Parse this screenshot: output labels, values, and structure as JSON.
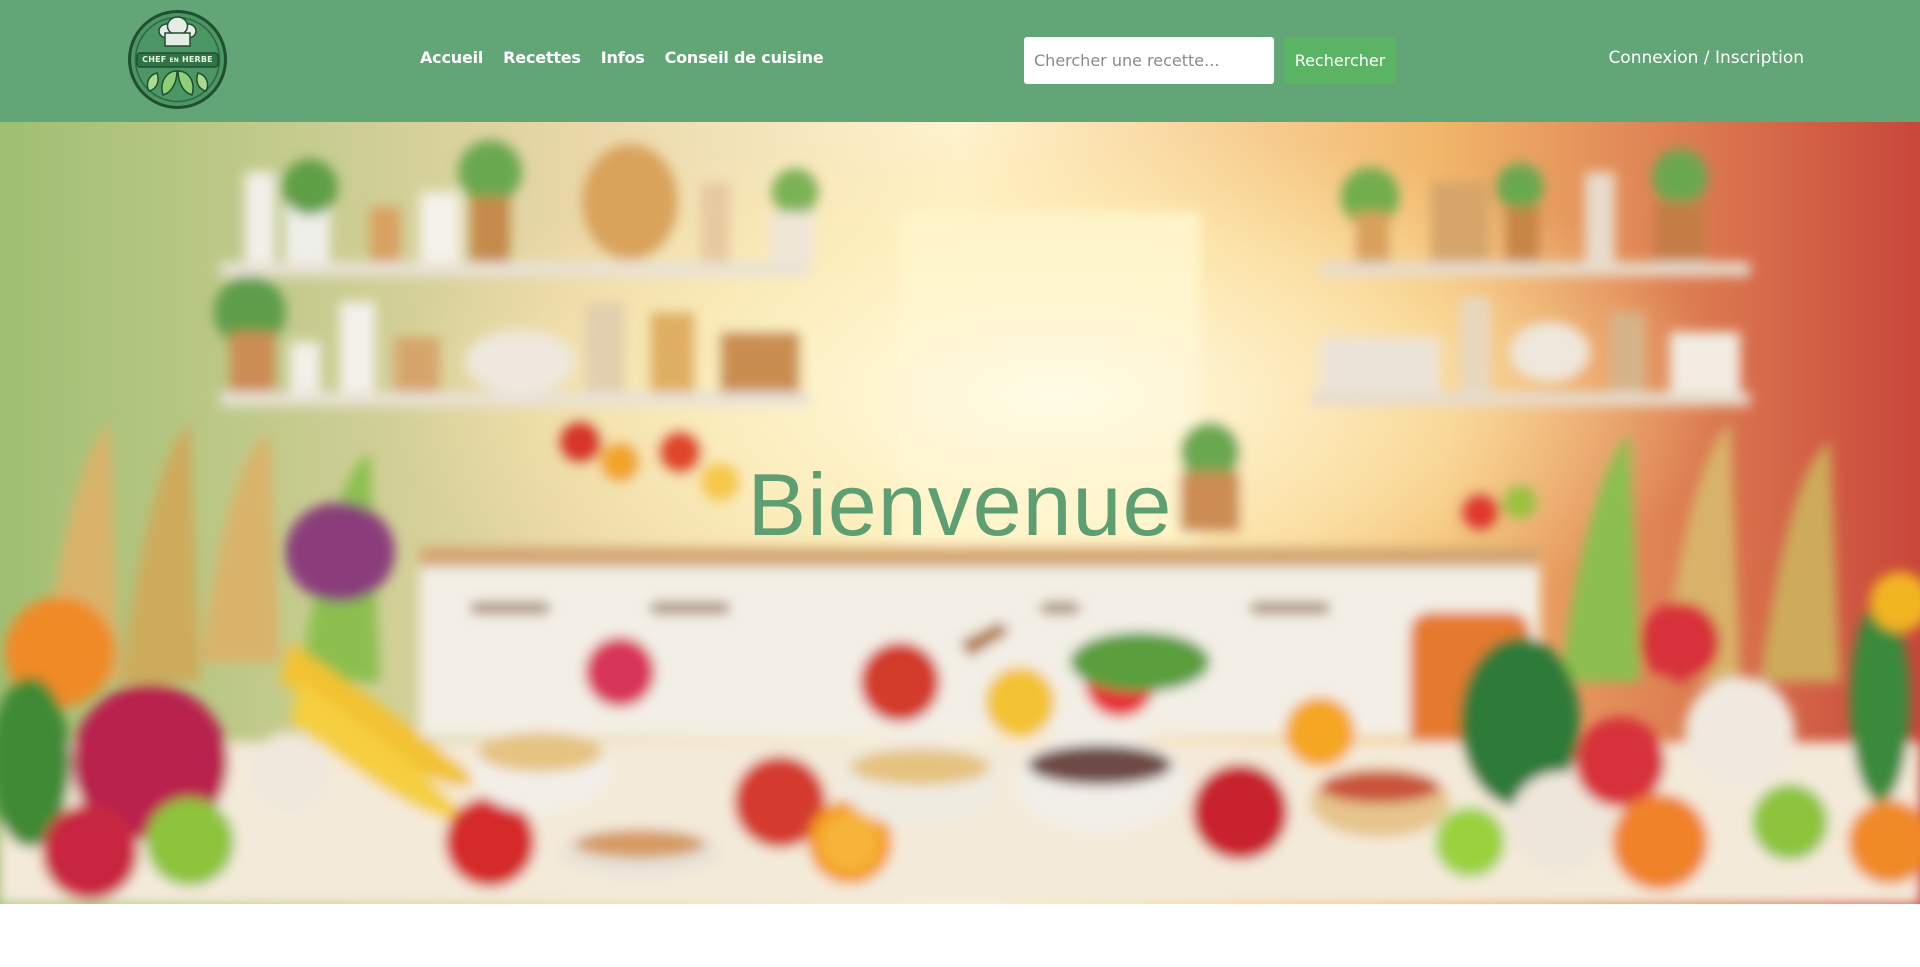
{
  "logo": {
    "text_top": "CHEF",
    "text_mid": "EN",
    "text_right": "HERBE",
    "icon": "chef-hat-herb-logo"
  },
  "nav": {
    "items": [
      {
        "label": "Accueil"
      },
      {
        "label": "Recettes"
      },
      {
        "label": "Infos"
      },
      {
        "label": "Conseil de cuisine"
      }
    ]
  },
  "search": {
    "placeholder": "Chercher une recette...",
    "value": "",
    "button_label": "Rechercher"
  },
  "auth": {
    "login_label": "Connexion",
    "separator": "/",
    "register_label": "Inscription"
  },
  "hero": {
    "title": "Bienvenue",
    "background": "blurred-kitchen-fruits-vegetables"
  },
  "colors": {
    "header_bg": "#62a576",
    "button_bg": "#5bb364",
    "title_color": "#5d9e72"
  }
}
